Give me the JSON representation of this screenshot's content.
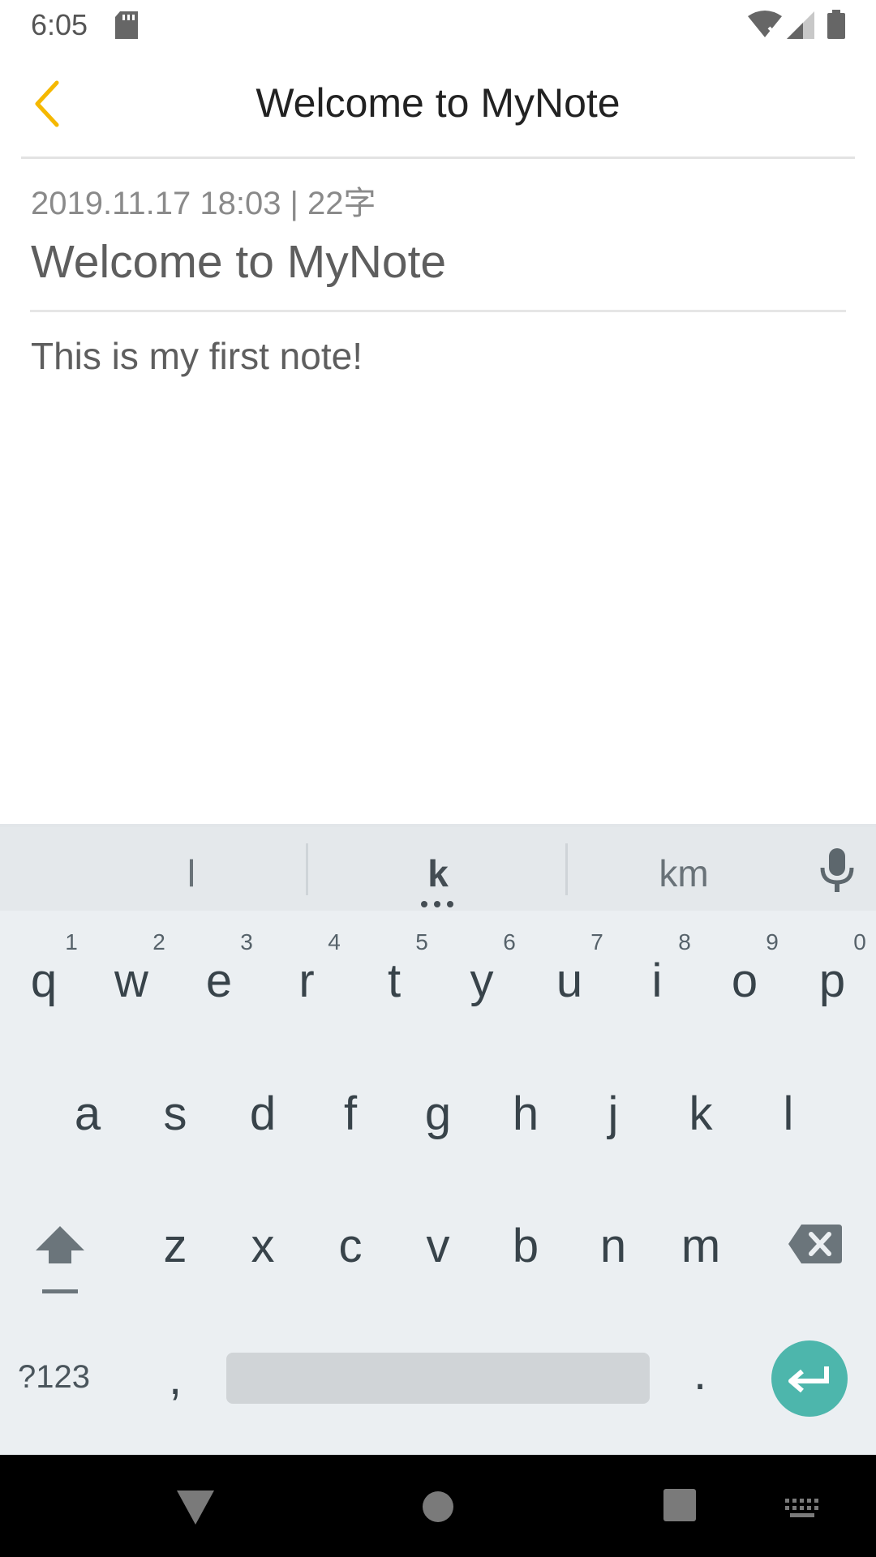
{
  "status_bar": {
    "time": "6:05"
  },
  "app_bar": {
    "title": "Welcome to MyNote"
  },
  "note": {
    "meta": "2019.11.17  18:03 | 22字",
    "title": "Welcome to MyNote",
    "body": "This is my first note!"
  },
  "keyboard": {
    "suggestions": [
      "l",
      "k",
      "km"
    ],
    "row1": [
      "q",
      "w",
      "e",
      "r",
      "t",
      "y",
      "u",
      "i",
      "o",
      "p"
    ],
    "row1_hints": [
      "1",
      "2",
      "3",
      "4",
      "5",
      "6",
      "7",
      "8",
      "9",
      "0"
    ],
    "row2": [
      "a",
      "s",
      "d",
      "f",
      "g",
      "h",
      "j",
      "k",
      "l"
    ],
    "row3": [
      "z",
      "x",
      "c",
      "v",
      "b",
      "n",
      "m"
    ],
    "symbols_label": "?123",
    "comma": ",",
    "period": "."
  },
  "colors": {
    "accent": "#f5b800",
    "enter": "#4db6ac",
    "keyboard_bg": "#ebeff2"
  }
}
